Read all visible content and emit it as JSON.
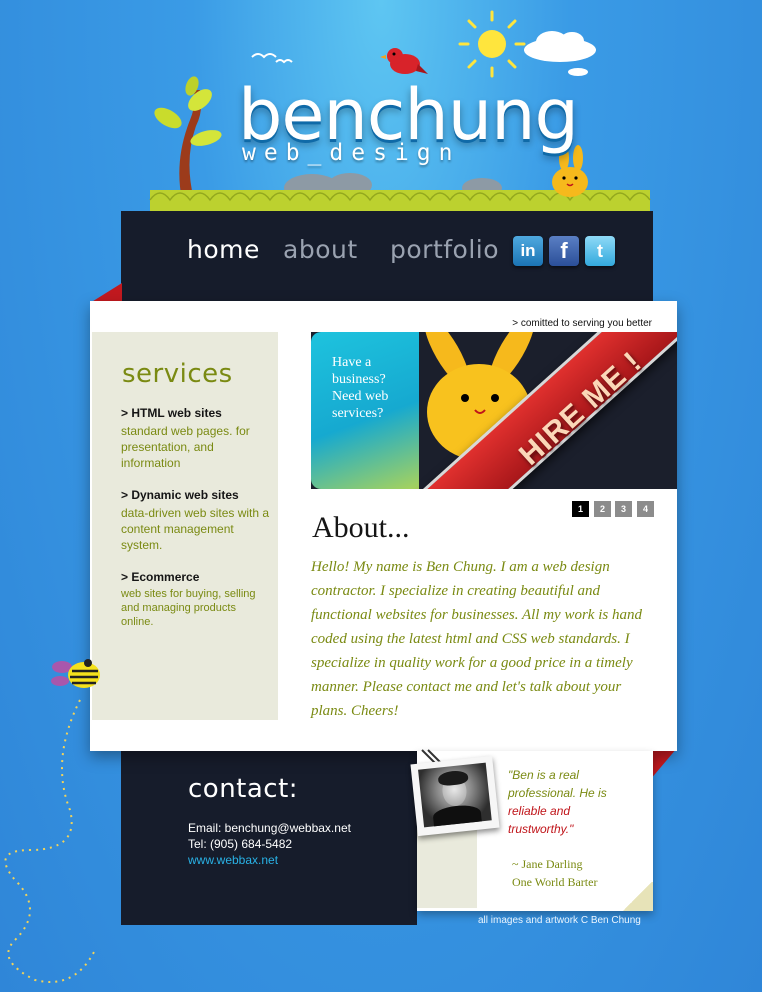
{
  "brand": {
    "name": "benchung",
    "tagline_sub": "web_design"
  },
  "nav": {
    "items": [
      {
        "label": "home",
        "active": true
      },
      {
        "label": "about",
        "active": false
      },
      {
        "label": "portfolio",
        "active": false
      }
    ],
    "social": [
      {
        "name": "linkedin-icon",
        "glyph": "in"
      },
      {
        "name": "facebook-icon",
        "glyph": "f"
      },
      {
        "name": "twitter-icon",
        "glyph": "t"
      }
    ]
  },
  "main": {
    "tagline": "> comitted to serving you better",
    "services": {
      "title": "services",
      "items": [
        {
          "heading": "> HTML web sites",
          "desc": "standard web pages. for presentation, and information"
        },
        {
          "heading": "> Dynamic web sites",
          "desc": "data-driven web sites with a content management system."
        },
        {
          "heading": "> Ecommerce",
          "desc": "web sites for buying, selling and managing products online."
        }
      ]
    },
    "banner": {
      "question": "Have a business? Need web services?",
      "cta": "HIRE ME !"
    },
    "pager": [
      "1",
      "2",
      "3",
      "4"
    ],
    "pager_active": 1,
    "about": {
      "title": "About...",
      "text": "Hello! My name is Ben Chung. I am a web design contractor. I specialize in creating beautiful and functional websites for businesses. All my work is hand coded using the latest html and CSS web standards. I specialize in quality work for a good price in a timely manner. Please contact me and let's talk about your plans.  Cheers!"
    }
  },
  "contact": {
    "title": "contact:",
    "email": "Email: benchung@webbax.net",
    "tel": "Tel: (905) 684-5482",
    "web": "www.webbax.net"
  },
  "testimonial": {
    "quote_start": "\"Ben is a real professional. He is ",
    "quote_red": "reliable and trustworthy.\"",
    "author": "~ Jane Darling",
    "company": "One World Barter"
  },
  "footer": {
    "copyright": "all images and artwork C Ben Chung"
  },
  "colors": {
    "background": "#2f86d8",
    "panel_dark": "#161c2b",
    "accent_green": "#7a8a12",
    "accent_red": "#c2191f",
    "link_cyan": "#29b2e6"
  }
}
